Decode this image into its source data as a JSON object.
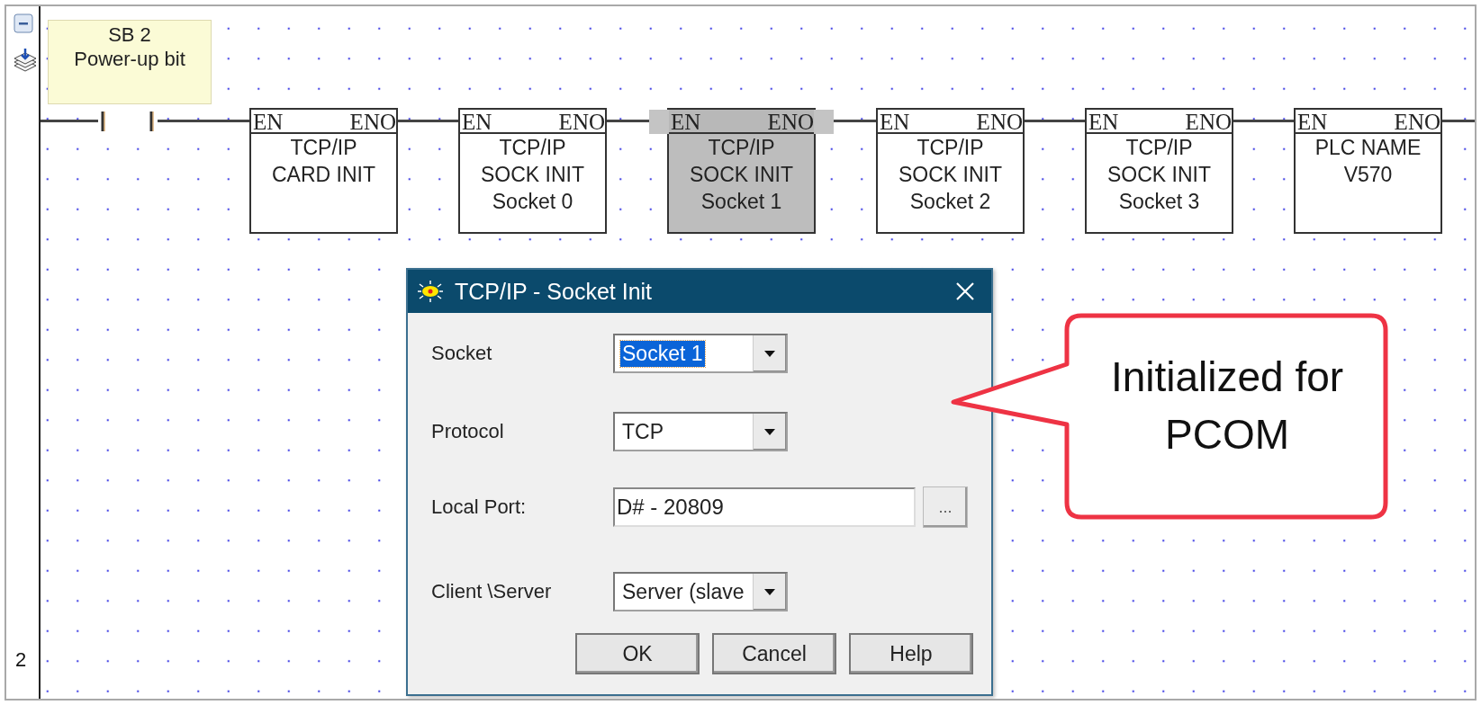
{
  "gutter": {
    "rung_number": "2"
  },
  "comment": {
    "title": "SB 2",
    "subtitle": "Power-up bit"
  },
  "blocks": [
    {
      "input": "EN",
      "output": "ENO",
      "lines": [
        "TCP/IP",
        "CARD INIT"
      ],
      "selected": false
    },
    {
      "input": "EN",
      "output": "ENO",
      "lines": [
        "TCP/IP",
        "SOCK INIT",
        "Socket 0"
      ],
      "selected": false
    },
    {
      "input": "EN",
      "output": "ENO",
      "lines": [
        "TCP/IP",
        "SOCK INIT",
        "Socket 1"
      ],
      "selected": true
    },
    {
      "input": "EN",
      "output": "ENO",
      "lines": [
        "TCP/IP",
        "SOCK INIT",
        "Socket 2"
      ],
      "selected": false
    },
    {
      "input": "EN",
      "output": "ENO",
      "lines": [
        "TCP/IP",
        "SOCK INIT",
        "Socket 3"
      ],
      "selected": false
    },
    {
      "input": "EN",
      "output": "ENO",
      "lines": [
        "PLC NAME",
        "V570"
      ],
      "selected": false
    }
  ],
  "dialog": {
    "title": "TCP/IP - Socket Init",
    "fields": [
      {
        "label": "Socket",
        "kind": "dropdown",
        "value": "Socket 1",
        "focused": true
      },
      {
        "label": "Protocol",
        "kind": "dropdown",
        "value": "TCP",
        "focused": false
      },
      {
        "label": "Local Port:",
        "kind": "browse",
        "value": "D# - 20809",
        "button": "...",
        "focused": false
      },
      {
        "label": "Client \\Server",
        "kind": "dropdown",
        "value": "Server (slave",
        "focused": false
      }
    ],
    "buttons": [
      "OK",
      "Cancel",
      "Help"
    ]
  },
  "callout": {
    "text": "Initialized for PCOM"
  }
}
